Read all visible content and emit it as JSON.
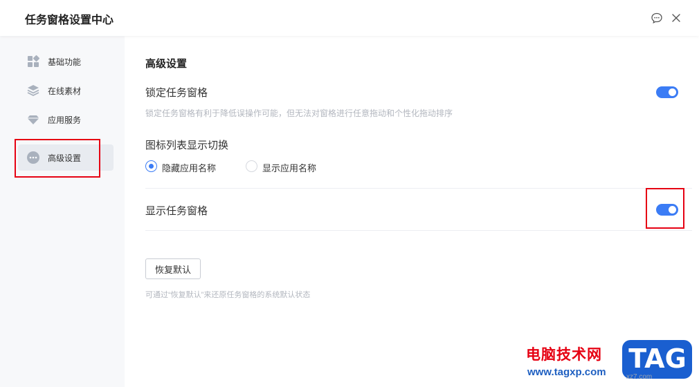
{
  "window": {
    "title": "任务窗格设置中心"
  },
  "sidebar": {
    "items": [
      {
        "label": "基础功能",
        "icon": "grid-icon",
        "active": false
      },
      {
        "label": "在线素材",
        "icon": "layers-icon",
        "active": false
      },
      {
        "label": "应用服务",
        "icon": "gem-icon",
        "active": false
      },
      {
        "label": "高级设置",
        "icon": "more-icon",
        "active": true
      }
    ]
  },
  "main": {
    "section_title": "高级设置",
    "lock_pane": {
      "label": "锁定任务窗格",
      "description": "锁定任务窗格有利于降低误操作可能，但无法对窗格进行任意拖动和个性化拖动排序",
      "enabled": true
    },
    "icon_list": {
      "label": "图标列表显示切换",
      "options": [
        "隐藏应用名称",
        "显示应用名称"
      ],
      "selected": "隐藏应用名称"
    },
    "show_pane": {
      "label": "显示任务窗格",
      "enabled": true
    },
    "restore": {
      "button_label": "恢复默认",
      "description": "可通过“恢复默认”来还原任务窗格的系统默认状态"
    }
  },
  "watermark": {
    "site_name": "电脑技术网",
    "url": "www.tagxp.com",
    "logo": "TAG",
    "small": "xz7.com"
  },
  "colors": {
    "accent": "#3b7cf5",
    "highlight_box": "#e60012",
    "sidebar_bg": "#f7f8fa",
    "active_item_bg": "#e8ebf0"
  }
}
